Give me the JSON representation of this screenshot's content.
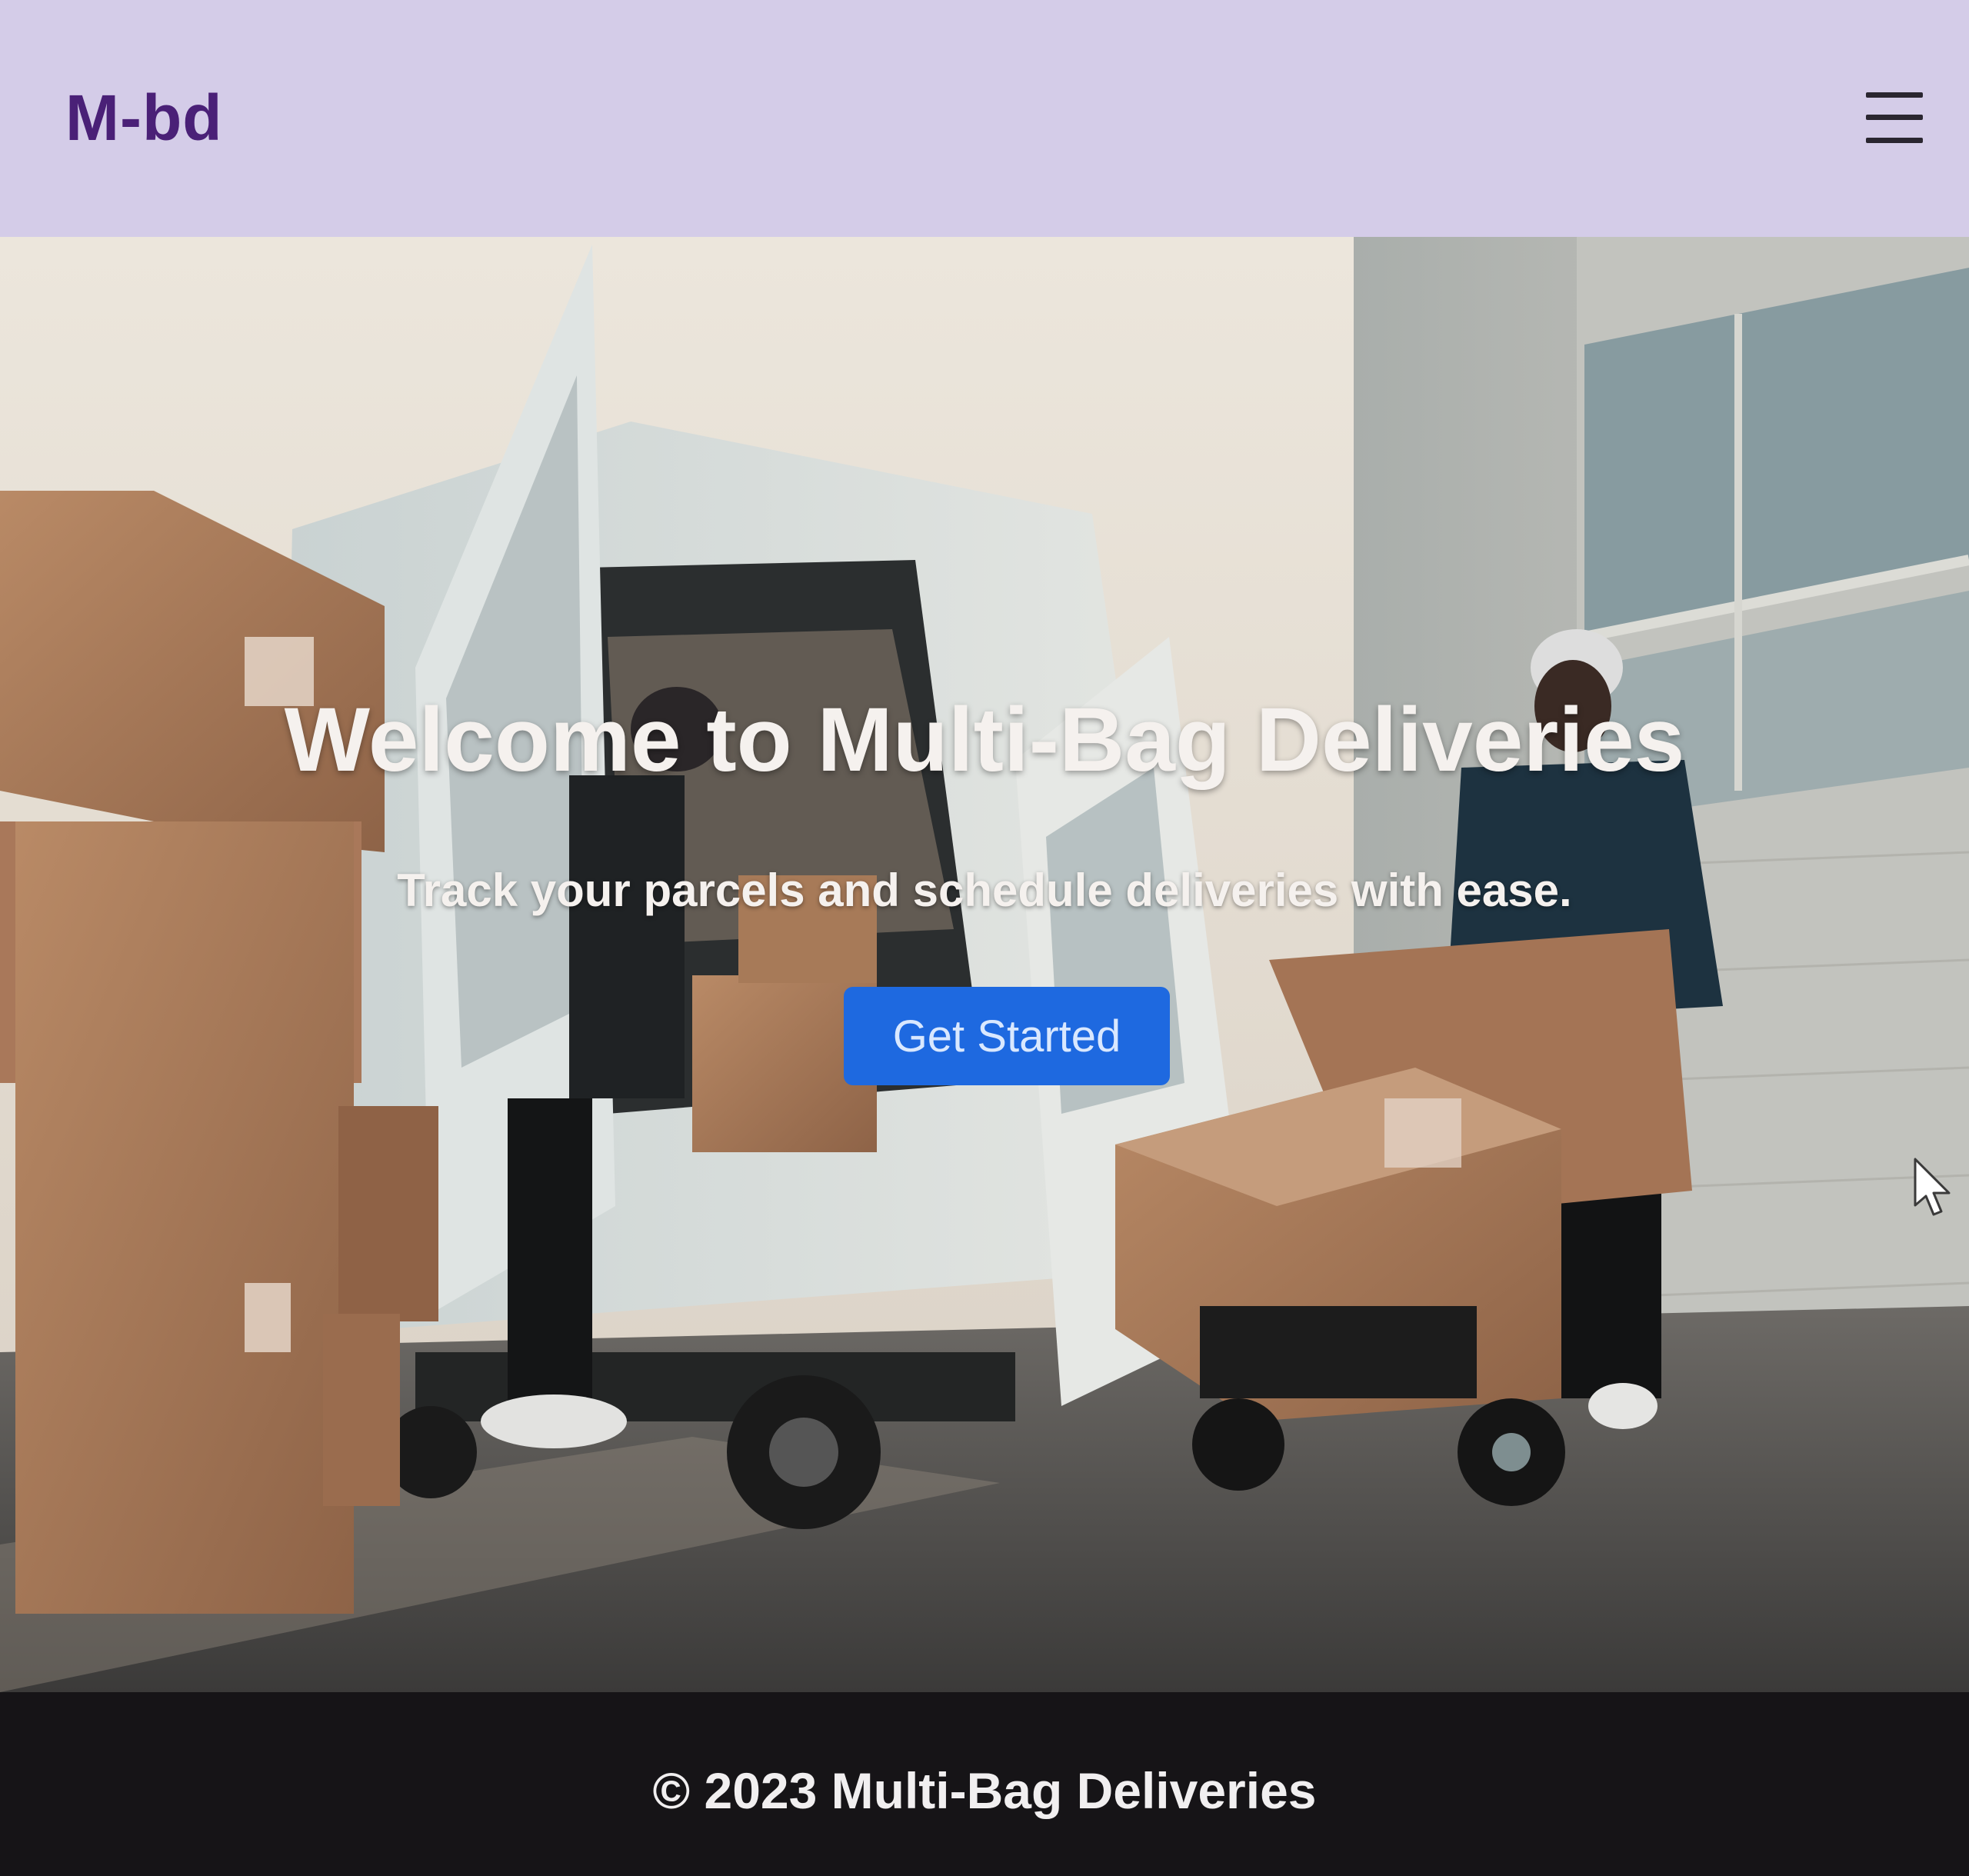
{
  "navbar": {
    "brand": "M-bd",
    "menu_icon": "hamburger-menu-icon"
  },
  "hero": {
    "title": "Welcome to Multi-Bag Deliveries",
    "subtitle": "Track your parcels and schedule deliveries with ease.",
    "cta_label": "Get Started",
    "background": "delivery-van-photo"
  },
  "footer": {
    "copyright": "© 2023 Multi-Bag Deliveries"
  },
  "colors": {
    "navbar_bg": "#d4cce8",
    "brand": "#4a2077",
    "cta_bg": "#1e69e0",
    "footer_bg": "#161417"
  }
}
